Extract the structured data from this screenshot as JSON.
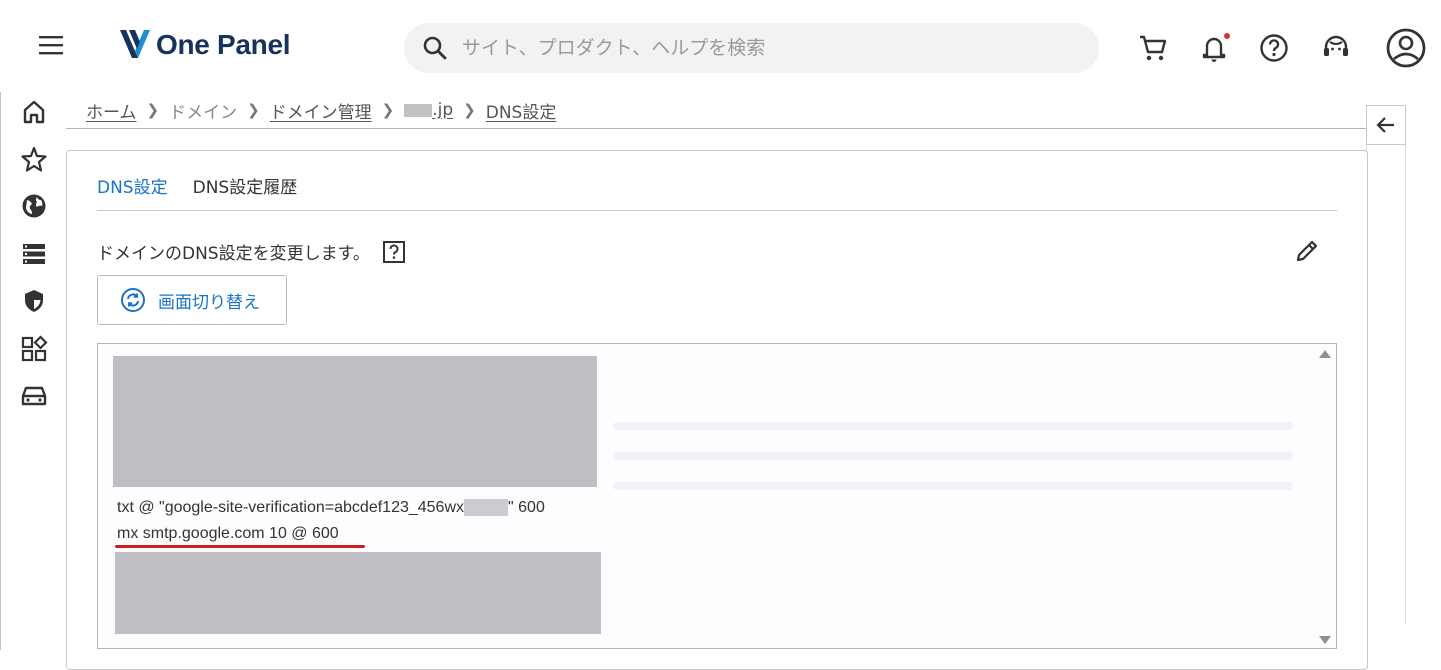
{
  "header": {
    "logo_text": "One Panel",
    "search_placeholder": "サイト、プロダクト、ヘルプを検索",
    "icons": [
      "menu-icon",
      "cart-icon",
      "bell-icon",
      "help-circle-icon",
      "support-icon",
      "account-icon"
    ],
    "notification_dot_color": "#e0312b",
    "brand_color": "#17325c"
  },
  "sidebar": {
    "icons": [
      "home-icon",
      "star-icon",
      "globe-icon",
      "server-icon",
      "shield-icon",
      "widgets-icon",
      "car-icon"
    ]
  },
  "breadcrumb": {
    "home": "ホーム",
    "domain": "ドメイン",
    "domain_manage": "ドメイン管理",
    "domain_suffix": ".jp",
    "current": "DNS設定"
  },
  "tabs": {
    "dns": "DNS設定",
    "history": "DNS設定履歴"
  },
  "content": {
    "description": "ドメインのDNS設定を変更します。",
    "switch_button": "画面切り替え",
    "accent_color": "#1a73c6"
  },
  "editor": {
    "line_txt_prefix": "txt @ \"google-site-verification=abcdef123_456wx",
    "line_txt_suffix": "\" 600",
    "line_mx": "mx smtp.google.com 10 @ 600",
    "highlight_color": "#cc1f1f"
  }
}
